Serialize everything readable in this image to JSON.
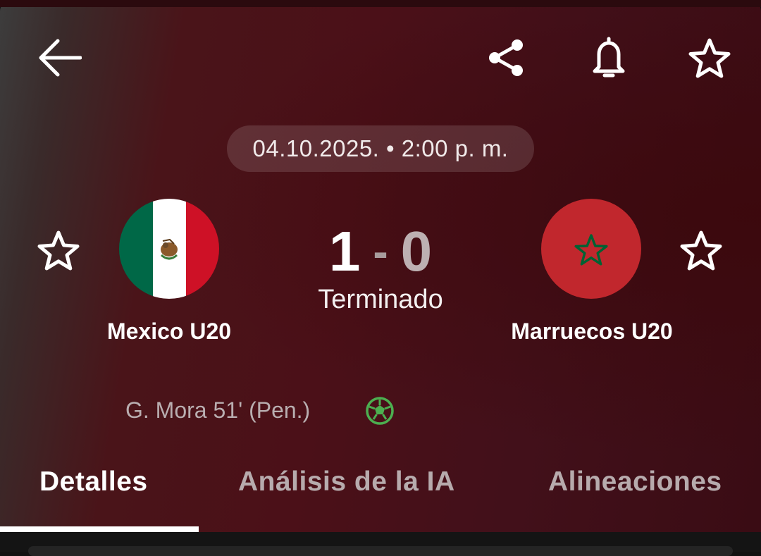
{
  "header": {
    "back_icon": "arrow-left-icon",
    "share_icon": "share-icon",
    "notify_icon": "bell-icon",
    "favorite_icon": "star-outline-icon"
  },
  "match": {
    "datetime": "04.10.2025. • 2:00 p. m.",
    "home_team": {
      "name": "Mexico U20",
      "flag": "mexico-flag",
      "favorite_icon": "star-outline-icon"
    },
    "away_team": {
      "name": "Marruecos U20",
      "flag": "morocco-flag",
      "favorite_icon": "star-outline-icon"
    },
    "score": {
      "home": "1",
      "separator": "-",
      "away": "0"
    },
    "status": "Terminado",
    "goals": [
      {
        "text": "G. Mora 51' (Pen.)",
        "icon": "soccer-ball-icon"
      }
    ]
  },
  "tabs": [
    {
      "label": "Detalles",
      "active": true
    },
    {
      "label": "Análisis de la IA",
      "active": false
    },
    {
      "label": "Alineaciones",
      "active": false
    }
  ],
  "colors": {
    "background_start": "#3d3d3d",
    "background_mid": "#4b1018",
    "mexico_green": "#006847",
    "mexico_red": "#ce1126",
    "morocco_red": "#c1272d",
    "morocco_star": "#006233",
    "ball_green": "#4caf50"
  }
}
